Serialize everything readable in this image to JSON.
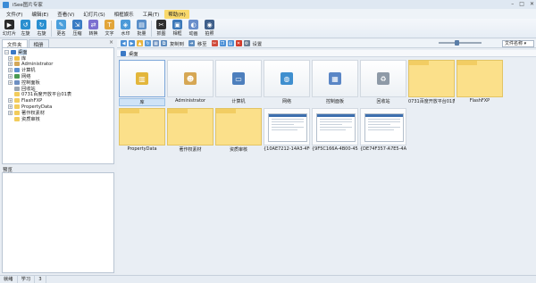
{
  "window": {
    "title": "iSee图片专家",
    "controls": [
      "–",
      "□",
      "✕"
    ]
  },
  "menu": [
    "文件(F)",
    "编辑(E)",
    "查看(V)",
    "幻灯片(S)",
    "相框娱乐",
    "工具(T)",
    "帮助(H)"
  ],
  "toolbar": [
    {
      "label": "幻灯片",
      "icon": "slideshow-icon",
      "color": "#2b2b2b"
    },
    {
      "label": "左旋",
      "icon": "rotate-left-icon",
      "color": "#2a8fd0"
    },
    {
      "label": "右旋",
      "icon": "rotate-right-icon",
      "color": "#2a8fd0"
    },
    {
      "label": "更名",
      "icon": "rename-icon",
      "color": "#4a9fdc"
    },
    {
      "label": "压缩",
      "icon": "compress-icon",
      "color": "#3a7cc4"
    },
    {
      "label": "转换",
      "icon": "convert-icon",
      "color": "#7b6fd0"
    },
    {
      "label": "文字",
      "icon": "text-icon",
      "color": "#e2a53a"
    },
    {
      "label": "水印",
      "icon": "watermark-icon",
      "color": "#4c9ad8"
    },
    {
      "label": "批量",
      "icon": "batch-icon",
      "color": "#5a8fc8"
    },
    {
      "label": "抓图",
      "icon": "capture-icon",
      "color": "#2e2e2e"
    },
    {
      "label": "相框",
      "icon": "frame-icon",
      "color": "#3c78b8"
    },
    {
      "label": "动画",
      "icon": "animation-icon",
      "color": "#6a8ecb"
    },
    {
      "label": "拍照",
      "icon": "camera-icon",
      "color": "#3f5f8a"
    }
  ],
  "left_tabs": [
    "文件夹",
    "相册"
  ],
  "tree": [
    {
      "label": "桌面",
      "toggle": "−",
      "color": "#3a79c6",
      "indent": 0,
      "selected": true
    },
    {
      "label": "库",
      "toggle": "+",
      "color": "#f0c24a",
      "indent": 1
    },
    {
      "label": "Administrator",
      "toggle": "+",
      "color": "#d4a85a",
      "indent": 1
    },
    {
      "label": "计算机",
      "toggle": "+",
      "color": "#5b8fcf",
      "indent": 1
    },
    {
      "label": "网络",
      "toggle": "+",
      "color": "#4b9a52",
      "indent": 1
    },
    {
      "label": "控制面板",
      "toggle": "+",
      "color": "#6d8fc2",
      "indent": 1
    },
    {
      "label": "回收站",
      "toggle": "",
      "color": "#9aa5b1",
      "indent": 1
    },
    {
      "label": "0731百度开放平台01表",
      "toggle": "",
      "color": "#f2cc5c",
      "indent": 1
    },
    {
      "label": "FlashFXP",
      "toggle": "+",
      "color": "#f2cc5c",
      "indent": 1
    },
    {
      "label": "PropertyData",
      "toggle": "+",
      "color": "#f2cc5c",
      "indent": 1
    },
    {
      "label": "著作权素材",
      "toggle": "+",
      "color": "#f2cc5c",
      "indent": 1
    },
    {
      "label": "资质审核",
      "toggle": "",
      "color": "#f2cc5c",
      "indent": 1
    }
  ],
  "preview_label": "预览",
  "content_toolbar": {
    "copy_to": "复制到",
    "move_to": "移至",
    "settings": "设置",
    "sort": "文件名称"
  },
  "path": "桌面",
  "items": [
    {
      "name": "库",
      "kind": "sys",
      "icon": "library-icon",
      "color": "#e3b63b",
      "selected": true
    },
    {
      "name": "Administrator",
      "kind": "sys",
      "icon": "user-folder-icon",
      "color": "#d6a754"
    },
    {
      "name": "计算机",
      "kind": "sys",
      "icon": "computer-icon",
      "color": "#4d7fbd"
    },
    {
      "name": "网络",
      "kind": "sys",
      "icon": "network-icon",
      "color": "#3f8fcf"
    },
    {
      "name": "控制面板",
      "kind": "sys",
      "icon": "control-panel-icon",
      "color": "#5a86c6"
    },
    {
      "name": "回收站",
      "kind": "sys",
      "icon": "recycle-bin-icon",
      "color": "#8e9aa7"
    },
    {
      "name": "0731百度开放平台01表",
      "kind": "folder"
    },
    {
      "name": "FlashFXP",
      "kind": "folder"
    },
    {
      "name": "PropertyData",
      "kind": "folder"
    },
    {
      "name": "著作权素材",
      "kind": "folder"
    },
    {
      "name": "资质审核",
      "kind": "folder"
    },
    {
      "name": "{10AE7212-14A3-4FC...",
      "kind": "shot"
    },
    {
      "name": "{9F5C166A-4B00-45A...",
      "kind": "shot"
    },
    {
      "name": "{DE74F357-A7E5-4A3...",
      "kind": "shot"
    }
  ],
  "status": [
    "就绪",
    "学习",
    "3"
  ]
}
